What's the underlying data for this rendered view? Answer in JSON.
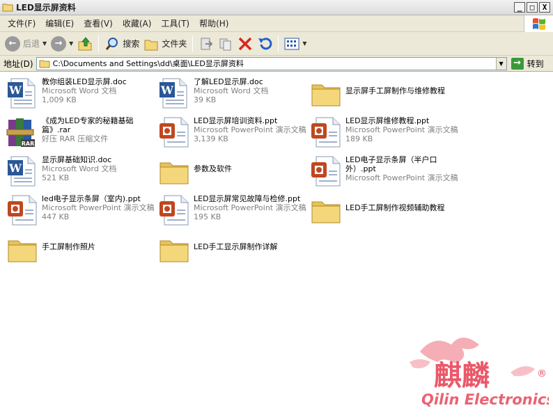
{
  "window": {
    "title": "LED显示屏资料",
    "min": "_",
    "max": "□",
    "close": "X"
  },
  "menu": [
    {
      "label": "文件(F)"
    },
    {
      "label": "编辑(E)"
    },
    {
      "label": "查看(V)"
    },
    {
      "label": "收藏(A)"
    },
    {
      "label": "工具(T)"
    },
    {
      "label": "帮助(H)"
    }
  ],
  "toolbar": {
    "back": "后退",
    "search": "搜索",
    "folders": "文件夹"
  },
  "address": {
    "label": "地址(D)",
    "path": "C:\\Documents and Settings\\dd\\桌面\\LED显示屏资料",
    "go": "转到"
  },
  "files": [
    {
      "type": "word",
      "name": "教你组装LED显示屏.doc",
      "kind": "Microsoft Word 文档",
      "size": "1,009 KB"
    },
    {
      "type": "word",
      "name": "了解LED显示屏.doc",
      "kind": "Microsoft Word 文档",
      "size": "39 KB"
    },
    {
      "type": "folder",
      "name": "显示屏手工屏制作与维修教程",
      "kind": "",
      "size": ""
    },
    {
      "type": "rar",
      "name": "《成为LED专家的秘籍基础篇》.rar",
      "kind": "好压 RAR 压缩文件",
      "size": ""
    },
    {
      "type": "ppt",
      "name": "LED显示屏培训资料.ppt",
      "kind": "Microsoft PowerPoint 演示文稿",
      "size": "3,139 KB"
    },
    {
      "type": "ppt",
      "name": "LED显示屏维修教程.ppt",
      "kind": "Microsoft PowerPoint 演示文稿",
      "size": "189 KB"
    },
    {
      "type": "word",
      "name": "显示屏基础知识.doc",
      "kind": "Microsoft Word 文档",
      "size": "521 KB"
    },
    {
      "type": "folder",
      "name": "参数及软件",
      "kind": "",
      "size": ""
    },
    {
      "type": "ppt",
      "name": "LED电子显示条屏（半户口外）.ppt",
      "kind": "Microsoft PowerPoint 演示文稿",
      "size": ""
    },
    {
      "type": "ppt",
      "name": "led电子显示条屏（室内).ppt",
      "kind": "Microsoft PowerPoint 演示文稿",
      "size": "447 KB"
    },
    {
      "type": "ppt",
      "name": "LED显示屏常见故障与检修.ppt",
      "kind": "Microsoft PowerPoint 演示文稿",
      "size": "195 KB"
    },
    {
      "type": "folder",
      "name": "LED手工屏制作视频辅助教程",
      "kind": "",
      "size": ""
    },
    {
      "type": "folder",
      "name": "手工屏制作照片",
      "kind": "",
      "size": ""
    },
    {
      "type": "folder",
      "name": "LED手工显示屏制作详解",
      "kind": "",
      "size": ""
    }
  ],
  "watermark": {
    "cn": "麒麟",
    "en": "Qilin Electronics",
    "mark": "®"
  },
  "colors": {
    "menubar": "#ece9d8",
    "word": "#2b5797",
    "ppt": "#c0471f",
    "folder": "#f4d77a",
    "watermark": "#e8475a"
  }
}
